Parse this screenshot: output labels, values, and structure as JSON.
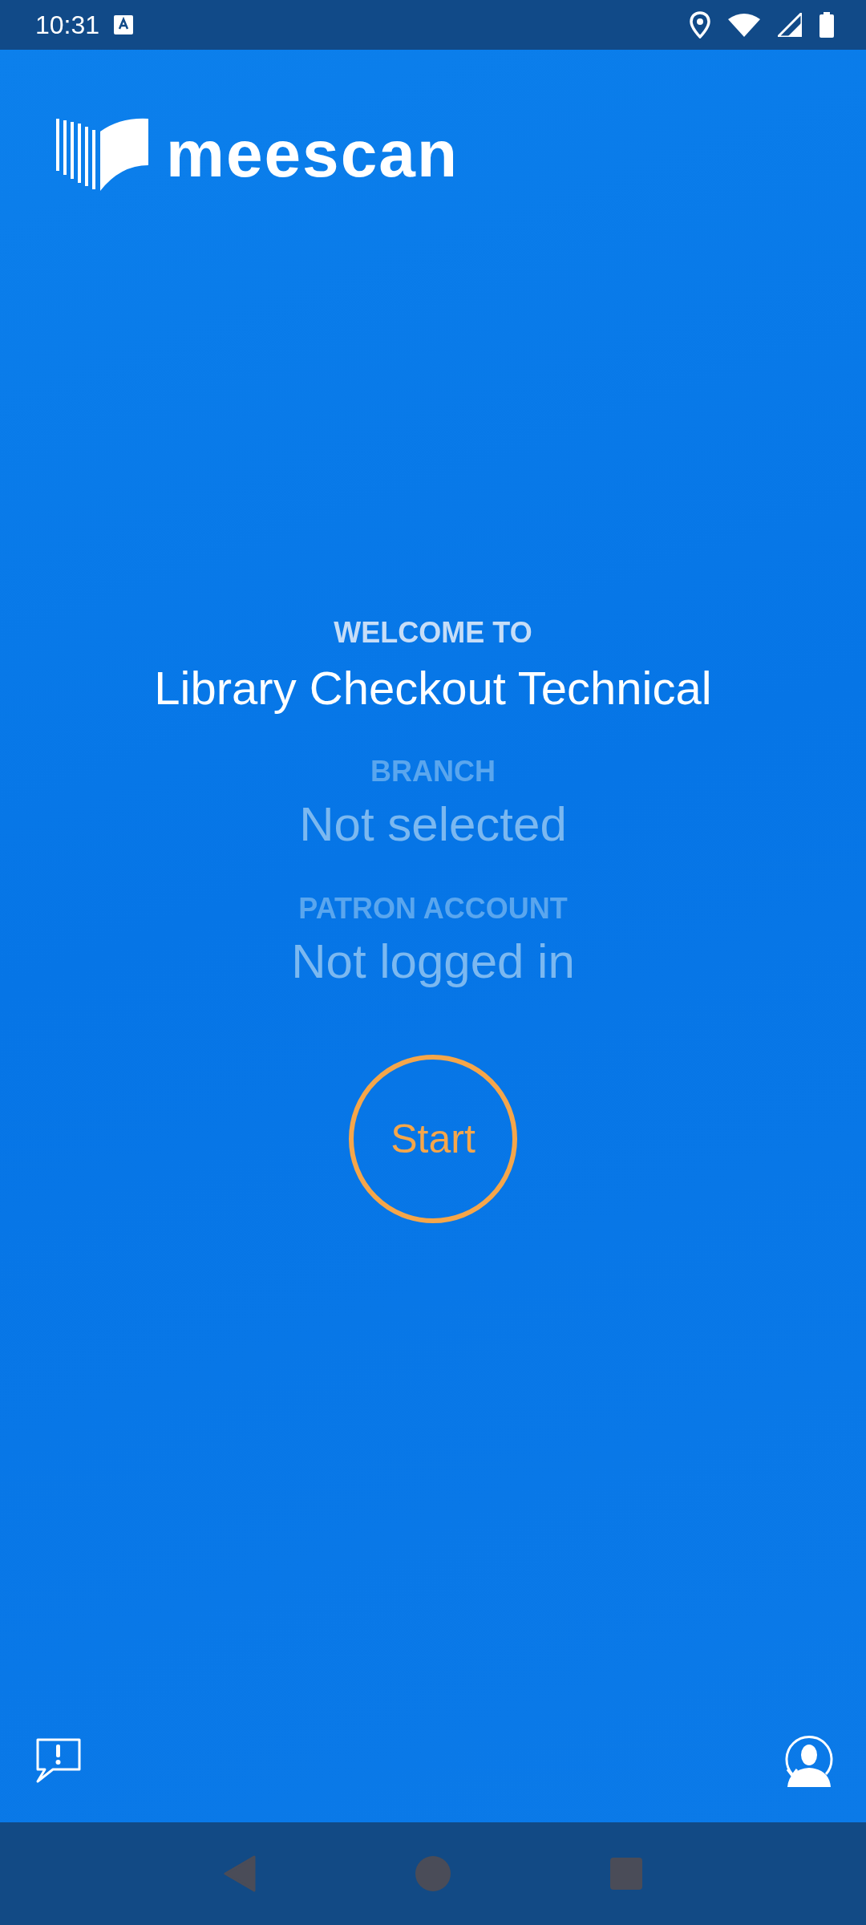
{
  "status_bar": {
    "time": "10:31"
  },
  "logo": {
    "text": "meescan"
  },
  "welcome": {
    "label": "WELCOME TO",
    "title": "Library Checkout Technical"
  },
  "fields": [
    {
      "label": "BRANCH",
      "value": "Not selected"
    },
    {
      "label": "PATRON ACCOUNT",
      "value": "Not logged in"
    }
  ],
  "start_button": {
    "label": "Start"
  }
}
